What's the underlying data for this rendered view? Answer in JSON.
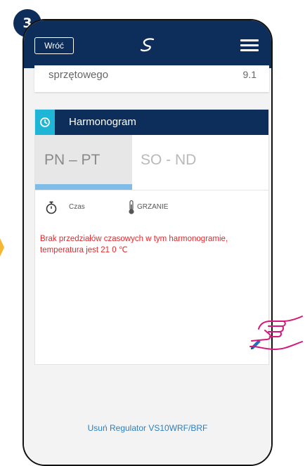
{
  "step": "3",
  "topbar": {
    "back_label": "Wróć",
    "logo_icon": "s-logo-icon",
    "menu_icon": "hamburger-icon"
  },
  "hardware": {
    "label": "sprzętowego",
    "value": "9.1"
  },
  "schedule": {
    "title": "Harmonogram",
    "tabs": [
      {
        "label": "PN – PT",
        "active": true
      },
      {
        "label": "SO - ND",
        "active": false
      }
    ],
    "legend": {
      "time_label": "Czas",
      "heating_label": "GRZANIE"
    },
    "message": "Brak przedziałów czasowych w tym harmonogramie, temperatura jest 21 0 ℃"
  },
  "remove_link": "Usuń Regulator VS10WRF/BRF",
  "colors": {
    "navy": "#0d2d5a",
    "cyan": "#1fb5d6",
    "tab_underline": "#7fbde8",
    "warning_text": "#e8262a",
    "link": "#2b7fbf",
    "hand": "#d6187b",
    "arrow": "#f6b633"
  }
}
